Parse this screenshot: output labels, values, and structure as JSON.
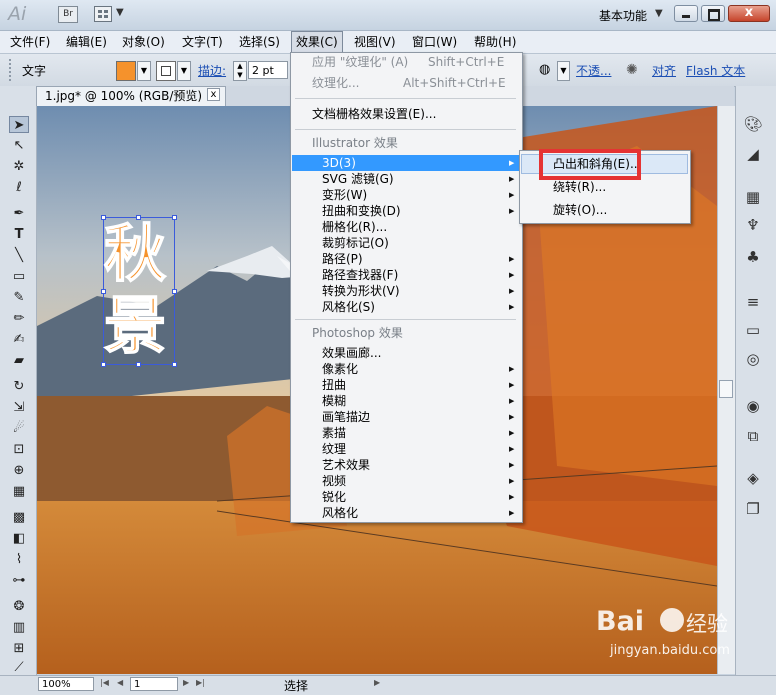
{
  "titlebar": {
    "app_logo": "Ai",
    "bridge_badge": "Br",
    "workspace": "基本功能",
    "close_symbol": "x"
  },
  "menubar": [
    {
      "label": "文件(F)"
    },
    {
      "label": "编辑(E)"
    },
    {
      "label": "对象(O)"
    },
    {
      "label": "文字(T)"
    },
    {
      "label": "选择(S)"
    },
    {
      "label": "效果(C)"
    },
    {
      "label": "视图(V)"
    },
    {
      "label": "窗口(W)"
    },
    {
      "label": "帮助(H)"
    }
  ],
  "controlbar": {
    "object_type": "文字",
    "fill_color": "#f5922c",
    "stroke_label": "描边:",
    "stroke_value": "2 pt",
    "opacity_label": "不透...",
    "align_label": "对齐",
    "flash_label": "Flash 文本"
  },
  "document": {
    "tab_title": "1.jpg* @ 100% (RGB/预览)",
    "tab_close": "x",
    "text_chars": [
      "秋",
      "景"
    ],
    "text_color": "#f5922c"
  },
  "effects_menu": {
    "apply_last": "应用 \"纹理化\" (A)",
    "apply_last_shortcut": "Shift+Ctrl+E",
    "last_effect": "纹理化...",
    "last_effect_shortcut": "Alt+Shift+Ctrl+E",
    "doc_raster_settings": "文档栅格效果设置(E)...",
    "illustrator_section": "Illustrator 效果",
    "illustrator_items": [
      {
        "label": "3D(3)"
      },
      {
        "label": "SVG 滤镜(G)"
      },
      {
        "label": "变形(W)"
      },
      {
        "label": "扭曲和变换(D)"
      },
      {
        "label": "栅格化(R)..."
      },
      {
        "label": "裁剪标记(O)"
      },
      {
        "label": "路径(P)"
      },
      {
        "label": "路径查找器(F)"
      },
      {
        "label": "转换为形状(V)"
      },
      {
        "label": "风格化(S)"
      }
    ],
    "photoshop_section": "Photoshop 效果",
    "photoshop_items": [
      {
        "label": "效果画廊..."
      },
      {
        "label": "像素化"
      },
      {
        "label": "扭曲"
      },
      {
        "label": "模糊"
      },
      {
        "label": "画笔描边"
      },
      {
        "label": "素描"
      },
      {
        "label": "纹理"
      },
      {
        "label": "艺术效果"
      },
      {
        "label": "视频"
      },
      {
        "label": "锐化"
      },
      {
        "label": "风格化"
      }
    ]
  },
  "submenu_3d": [
    {
      "label": "凸出和斜角(E)..."
    },
    {
      "label": "绕转(R)..."
    },
    {
      "label": "旋转(O)..."
    }
  ],
  "statusbar": {
    "zoom": "100%",
    "page": "1",
    "status": "选择"
  },
  "watermark": {
    "brand": "Bai",
    "brand_cn": "经验",
    "url": "jingyan.baidu.com"
  },
  "colors": {
    "menu_highlight": "#3399ff",
    "annotation": "#e53333"
  }
}
